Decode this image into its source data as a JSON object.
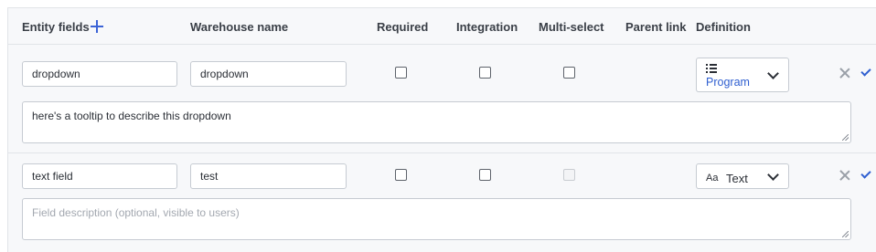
{
  "header": {
    "entity_fields": "Entity fields",
    "warehouse_name": "Warehouse name",
    "required": "Required",
    "integration": "Integration",
    "multi_select": "Multi-select",
    "parent_link": "Parent link",
    "definition": "Definition"
  },
  "rows": [
    {
      "entity_field": "dropdown",
      "warehouse_name": "dropdown",
      "required": false,
      "integration": false,
      "multi_select": false,
      "multi_select_disabled": false,
      "definition_icon": "list-icon",
      "definition": "Program",
      "description": "here's a tooltip to describe this dropdown",
      "description_placeholder": ""
    },
    {
      "entity_field": "text field",
      "warehouse_name": "test",
      "required": false,
      "integration": false,
      "multi_select": false,
      "multi_select_disabled": true,
      "definition_icon": "text-type-icon",
      "definition_icon_glyph": "Aa",
      "definition": "Text",
      "description": "",
      "description_placeholder": "Field description (optional, visible to users)"
    }
  ],
  "colors": {
    "accent": "#2f5fd0",
    "header_bg": "#f7f8fa",
    "border": "#e1e4e8"
  }
}
